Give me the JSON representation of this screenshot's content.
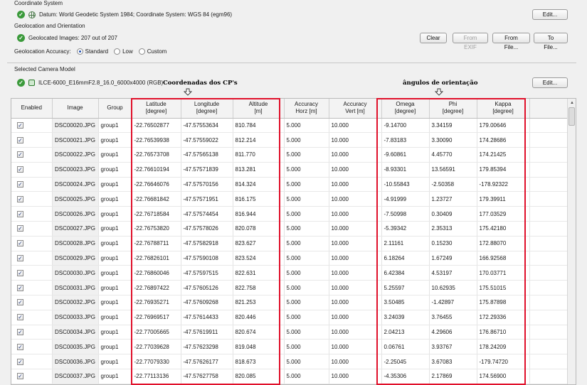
{
  "coordinate_system": {
    "label": "Coordinate System",
    "datum_text": "Datum: World Geodetic System 1984; Coordinate System: WGS 84 (egm96)",
    "edit_label": "Edit..."
  },
  "geolocation": {
    "label": "Geolocation and Orientation",
    "status_text": "Geolocated Images: 207 out of 207",
    "buttons": {
      "clear": "Clear",
      "from_exif": "From EXIF",
      "from_file": "From File...",
      "to_file": "To File..."
    },
    "accuracy_label": "Geolocation Accuracy:",
    "accuracy_options": [
      "Standard",
      "Low",
      "Custom"
    ],
    "accuracy_selected": "Standard"
  },
  "camera_model": {
    "label": "Selected Camera Model",
    "model_text": "ILCE-6000_E16mmF2.8_16.0_6000x4000 (RGB)",
    "edit_label": "Edit..."
  },
  "annotations": {
    "cp_coords": "Coordenadas dos CP's",
    "orientation": "ângulos de orientação"
  },
  "colors": {
    "highlight_box": "#e0102a",
    "check_green": "#3b9a3b"
  },
  "table": {
    "headers": [
      {
        "l1": "Enabled",
        "l2": ""
      },
      {
        "l1": "Image",
        "l2": ""
      },
      {
        "l1": "Group",
        "l2": ""
      },
      {
        "l1": "Latitude",
        "l2": "[degree]"
      },
      {
        "l1": "Longitude",
        "l2": "[degree]"
      },
      {
        "l1": "Altitude",
        "l2": "[m]"
      },
      {
        "l1": "Accuracy",
        "l2": "Horz [m]"
      },
      {
        "l1": "Accuracy",
        "l2": "Vert [m]"
      },
      {
        "l1": "Omega",
        "l2": "[degree]"
      },
      {
        "l1": "Phi",
        "l2": "[degree]"
      },
      {
        "l1": "Kappa",
        "l2": "[degree]"
      }
    ],
    "rows": [
      [
        "DSC00020.JPG",
        "group1",
        "-22.76502877",
        "-47.57553634",
        "810.784",
        "5.000",
        "10.000",
        "-9.14700",
        "3.34159",
        "179.00646"
      ],
      [
        "DSC00021.JPG",
        "group1",
        "-22.76539938",
        "-47.57559022",
        "812.214",
        "5.000",
        "10.000",
        "-7.83183",
        "3.30090",
        "174.28686"
      ],
      [
        "DSC00022.JPG",
        "group1",
        "-22.76573708",
        "-47.57565138",
        "811.770",
        "5.000",
        "10.000",
        "-9.60861",
        "4.45770",
        "174.21425"
      ],
      [
        "DSC00023.JPG",
        "group1",
        "-22.76610194",
        "-47.57571839",
        "813.281",
        "5.000",
        "10.000",
        "-8.93301",
        "13.56591",
        "179.85394"
      ],
      [
        "DSC00024.JPG",
        "group1",
        "-22.76646076",
        "-47.57570156",
        "814.324",
        "5.000",
        "10.000",
        "-10.55843",
        "-2.50358",
        "-178.92322"
      ],
      [
        "DSC00025.JPG",
        "group1",
        "-22.76681842",
        "-47.57571951",
        "816.175",
        "5.000",
        "10.000",
        "-4.91999",
        "1.23727",
        "179.39911"
      ],
      [
        "DSC00026.JPG",
        "group1",
        "-22.76718584",
        "-47.57574454",
        "816.944",
        "5.000",
        "10.000",
        "-7.50998",
        "0.30409",
        "177.03529"
      ],
      [
        "DSC00027.JPG",
        "group1",
        "-22.76753820",
        "-47.57578026",
        "820.078",
        "5.000",
        "10.000",
        "-5.39342",
        "2.35313",
        "175.42180"
      ],
      [
        "DSC00028.JPG",
        "group1",
        "-22.76788711",
        "-47.57582918",
        "823.627",
        "5.000",
        "10.000",
        "2.11161",
        "0.15230",
        "172.88070"
      ],
      [
        "DSC00029.JPG",
        "group1",
        "-22.76826101",
        "-47.57590108",
        "823.524",
        "5.000",
        "10.000",
        "6.18264",
        "1.67249",
        "166.92568"
      ],
      [
        "DSC00030.JPG",
        "group1",
        "-22.76860046",
        "-47.57597515",
        "822.631",
        "5.000",
        "10.000",
        "6.42384",
        "4.53197",
        "170.03771"
      ],
      [
        "DSC00031.JPG",
        "group1",
        "-22.76897422",
        "-47.57605126",
        "822.758",
        "5.000",
        "10.000",
        "5.25597",
        "10.62935",
        "175.51015"
      ],
      [
        "DSC00032.JPG",
        "group1",
        "-22.76935271",
        "-47.57609268",
        "821.253",
        "5.000",
        "10.000",
        "3.50485",
        "-1.42897",
        "175.87898"
      ],
      [
        "DSC00033.JPG",
        "group1",
        "-22.76969517",
        "-47.57614433",
        "820.446",
        "5.000",
        "10.000",
        "3.24039",
        "3.76455",
        "172.29336"
      ],
      [
        "DSC00034.JPG",
        "group1",
        "-22.77005665",
        "-47.57619911",
        "820.674",
        "5.000",
        "10.000",
        "2.04213",
        "4.29606",
        "176.86710"
      ],
      [
        "DSC00035.JPG",
        "group1",
        "-22.77039628",
        "-47.57623298",
        "819.048",
        "5.000",
        "10.000",
        "0.06761",
        "3.93767",
        "178.24209"
      ],
      [
        "DSC00036.JPG",
        "group1",
        "-22.77079330",
        "-47.57626177",
        "818.673",
        "5.000",
        "10.000",
        "-2.25045",
        "3.67083",
        "-179.74720"
      ],
      [
        "DSC00037.JPG",
        "group1",
        "-22.77113136",
        "-47.57627758",
        "820.085",
        "5.000",
        "10.000",
        "-4.35306",
        "2.17869",
        "174.56900"
      ]
    ]
  }
}
